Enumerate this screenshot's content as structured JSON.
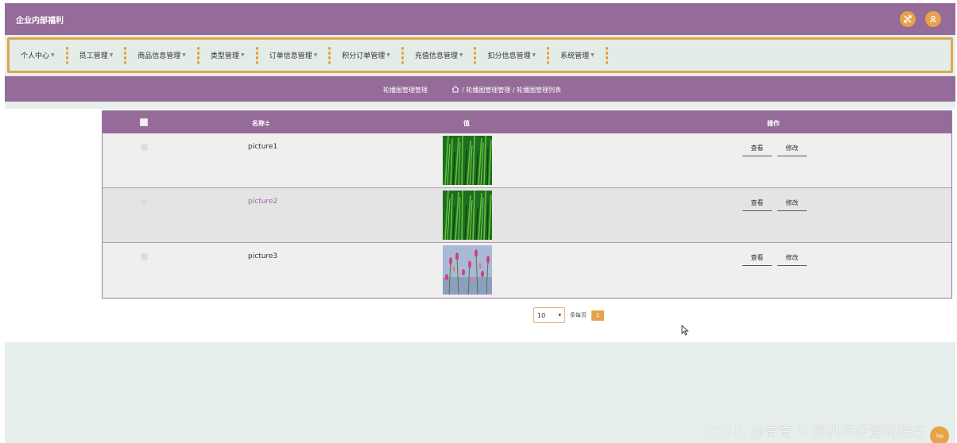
{
  "app": {
    "title": "企业内部福利"
  },
  "topbar_icons": [
    "shuffle-icon",
    "user-icon"
  ],
  "nav": {
    "items": [
      {
        "label": "个人中心"
      },
      {
        "label": "员工管理"
      },
      {
        "label": "商品信息管理"
      },
      {
        "label": "类型管理"
      },
      {
        "label": "订单信息管理"
      },
      {
        "label": "积分订单管理"
      },
      {
        "label": "充值信息管理"
      },
      {
        "label": "扣分信息管理"
      },
      {
        "label": "系统管理"
      }
    ]
  },
  "breadcrumb": {
    "title": "轮播图管理管理",
    "path": "/ 轮播图管理管理 / 轮播图管理列表"
  },
  "table": {
    "headers": {
      "name": "名称≑",
      "value": "值",
      "op": "操作"
    },
    "rows": [
      {
        "name": "picture1",
        "image": "grass"
      },
      {
        "name": "picture2",
        "image": "grass"
      },
      {
        "name": "picture3",
        "image": "flowers"
      }
    ],
    "view_label": "查看",
    "edit_label": "修改"
  },
  "pager": {
    "page_size": "10",
    "per_page_label": "条每页",
    "current_page": "1"
  },
  "watermark": "CSDN @青青  计算机毕设源码程序",
  "fab_label": "Top",
  "colors": {
    "primary": "#956b99",
    "accent": "#e8a24a",
    "background": "#e6efeb"
  }
}
